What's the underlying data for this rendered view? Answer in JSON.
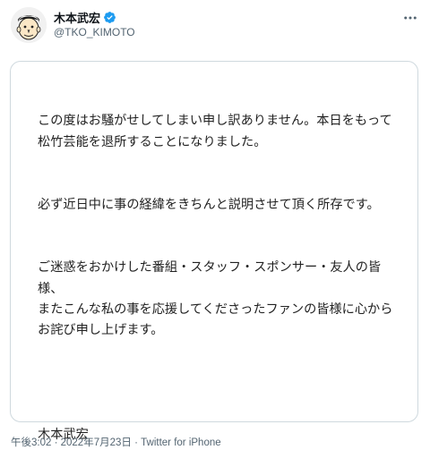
{
  "author": {
    "display_name": "木本武宏",
    "handle": "@TKO_KIMOTO",
    "verified_icon": "verified-badge-icon",
    "avatar_icon": "avatar-caricature",
    "verified_color": "#1d9bf0"
  },
  "menu": {
    "more_icon": "more-horizontal-icon"
  },
  "card": {
    "paragraphs": [
      "この度はお騒がせしてしまい申し訳ありません。本日をもって松竹芸能を退所することになりました。",
      "必ず近日中に事の経緯をきちんと説明させて頂く所存です。",
      "ご迷惑をおかけした番組・スタッフ・スポンサー・友人の皆様、\nまたこんな私の事を応援してくださったファンの皆様に心からお詫び申し上げます。"
    ],
    "signature": "木本武宏"
  },
  "meta": {
    "time": "午後3:02",
    "sep1": " · ",
    "date": "2022年7月23日",
    "sep2": " · ",
    "source": "Twitter for iPhone"
  },
  "colors": {
    "text": "#0f1419",
    "secondary": "#536471",
    "border": "#cfd9de",
    "accent": "#1d9bf0"
  }
}
